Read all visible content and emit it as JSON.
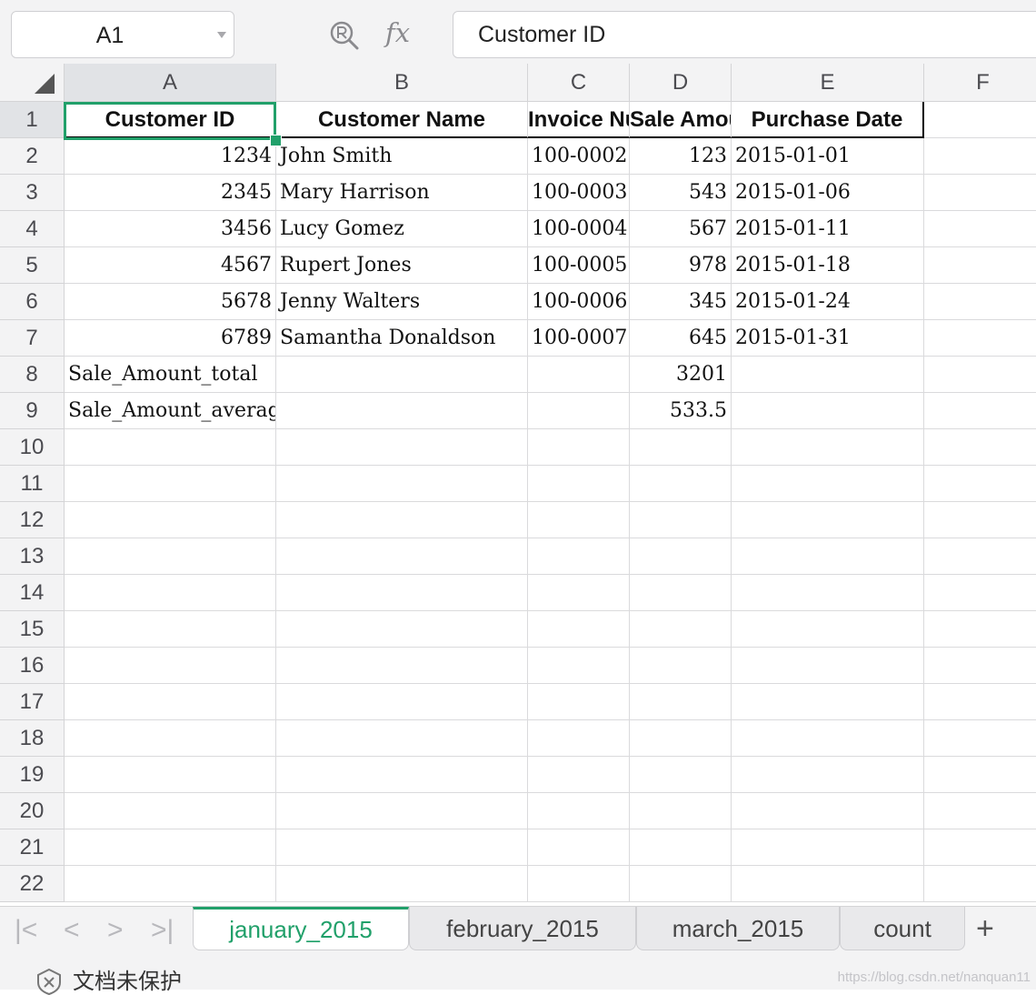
{
  "formula_bar": {
    "cell_ref": "A1",
    "fx_label": "fx",
    "formula_value": "Customer ID"
  },
  "columns": [
    "A",
    "B",
    "C",
    "D",
    "E",
    "F"
  ],
  "rows": [
    "1",
    "2",
    "3",
    "4",
    "5",
    "6",
    "7",
    "8",
    "9",
    "10",
    "11",
    "12",
    "13",
    "14",
    "15",
    "16",
    "17",
    "18",
    "19",
    "20",
    "21",
    "22"
  ],
  "cells": {
    "header": [
      "Customer ID",
      "Customer Name",
      "Invoice Number",
      "Sale Amount",
      "Purchase Date"
    ],
    "data": [
      [
        "1234",
        "John Smith",
        "100-0002",
        "123",
        "2015-01-01"
      ],
      [
        "2345",
        "Mary Harrison",
        "100-0003",
        "543",
        "2015-01-06"
      ],
      [
        "3456",
        "Lucy Gomez",
        "100-0004",
        "567",
        "2015-01-11"
      ],
      [
        "4567",
        "Rupert Jones",
        "100-0005",
        "978",
        "2015-01-18"
      ],
      [
        "5678",
        "Jenny Walters",
        "100-0006",
        "345",
        "2015-01-24"
      ],
      [
        "6789",
        "Samantha Donaldson",
        "100-0007",
        "645",
        "2015-01-31"
      ]
    ],
    "total_label": "Sale_Amount_total",
    "total_value": "3201",
    "average_label": "Sale_Amount_average",
    "average_value": "533.5"
  },
  "sheet_tabs": [
    {
      "label": "january_2015",
      "active": true
    },
    {
      "label": "february_2015",
      "active": false
    },
    {
      "label": "march_2015",
      "active": false
    },
    {
      "label": "count",
      "active": false
    }
  ],
  "nav_glyphs": [
    "|<",
    "<",
    ">",
    ">|"
  ],
  "add_sheet_label": "+",
  "status": {
    "protection_text": "文档未保护",
    "watermark": "https://blog.csdn.net/nanquan11"
  },
  "colors": {
    "accent": "#21a06a",
    "header_bg": "#f3f3f4",
    "selected_header_bg": "#e1e3e6"
  },
  "icons": [
    "zoom-formula-icon",
    "fx-icon",
    "shield-icon",
    "dropdown-caret-icon"
  ]
}
